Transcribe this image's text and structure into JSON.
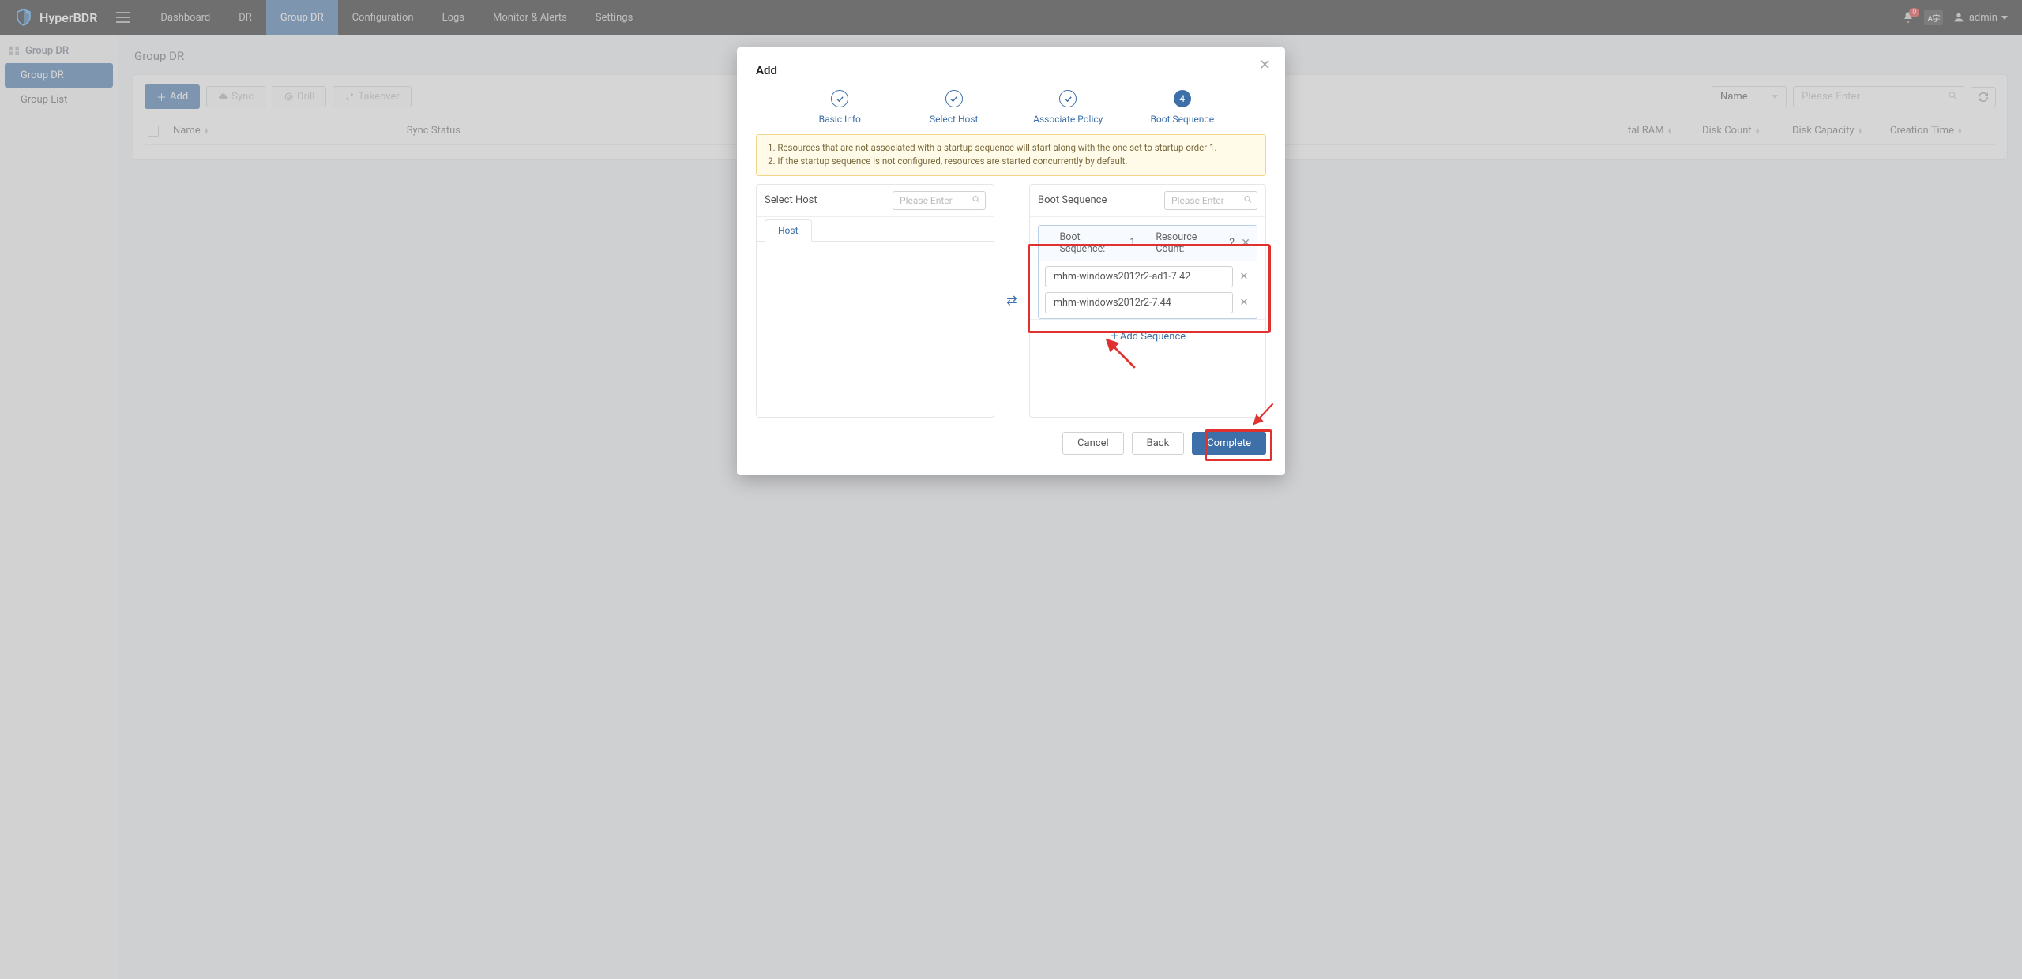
{
  "brand": "HyperBDR",
  "nav": {
    "items": [
      "Dashboard",
      "DR",
      "Group DR",
      "Configuration",
      "Logs",
      "Monitor & Alerts",
      "Settings"
    ],
    "activeIndex": 2
  },
  "notifications": {
    "count": "0"
  },
  "lang_badge": "A字",
  "user": {
    "name": "admin"
  },
  "sidebar": {
    "headLabel": "Group DR",
    "items": [
      "Group DR",
      "Group List"
    ],
    "activeIndex": 0
  },
  "page": {
    "title": "Group DR",
    "toolbar": {
      "add": "Add",
      "sync": "Sync",
      "drill": "Drill",
      "takeover": "Takeover"
    },
    "filter": {
      "fieldLabel": "Name",
      "placeholder": "Please Enter"
    },
    "columns": [
      "Name",
      "Sync Status",
      "tal RAM",
      "Disk Count",
      "Disk Capacity",
      "Creation Time"
    ]
  },
  "modal": {
    "title": "Add",
    "steps": [
      "Basic Info",
      "Select Host",
      "Associate Policy",
      "Boot Sequence"
    ],
    "currentStepIndex": 3,
    "currentStepNumber": "4",
    "alert": {
      "line1": "1. Resources that are not associated with a startup sequence will start along with the one set to startup order 1.",
      "line2": "2. If the startup sequence is not configured, resources are started concurrently by default."
    },
    "leftPanel": {
      "label": "Select Host",
      "placeholder": "Please Enter",
      "tab": "Host"
    },
    "rightPanel": {
      "label": "Boot Sequence",
      "placeholder": "Please Enter",
      "sequence": {
        "titlePrefix": "Boot Sequence:",
        "titleNumber": "1",
        "countPrefix": "Resource Count:",
        "countNumber": "2",
        "items": [
          "mhm-windows2012r2-ad1-7.42",
          "mhm-windows2012r2-7.44"
        ]
      },
      "addSequence": "Add Sequence"
    },
    "footer": {
      "cancel": "Cancel",
      "back": "Back",
      "complete": "Complete"
    }
  }
}
